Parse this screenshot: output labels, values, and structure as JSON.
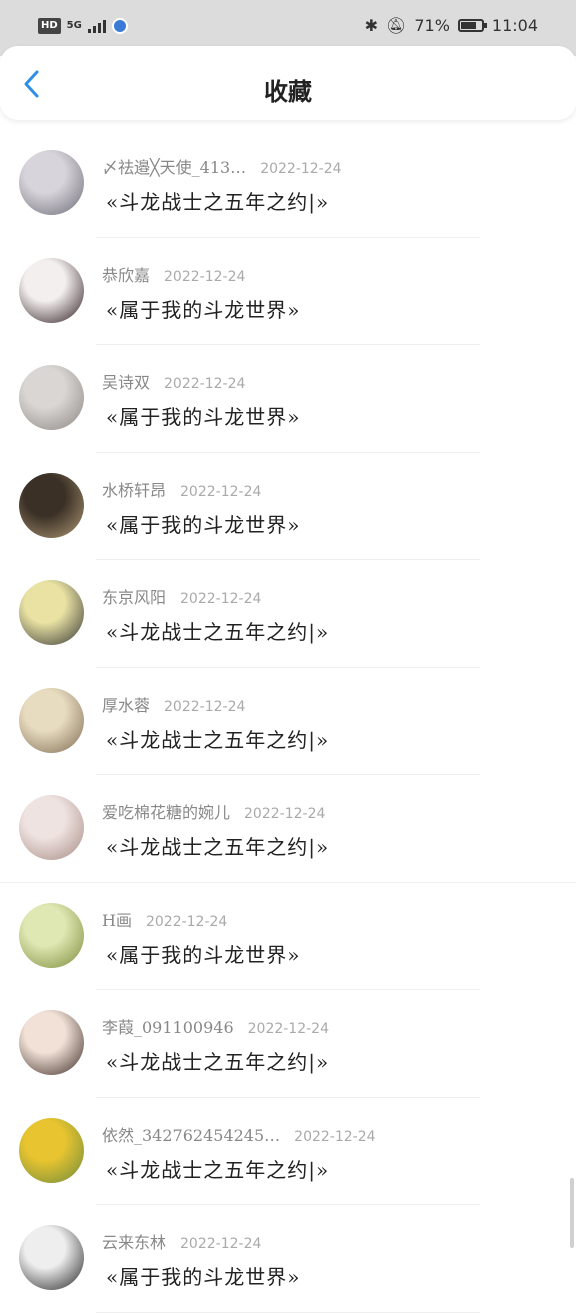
{
  "status_bar": {
    "left_badge": "HD",
    "network": "5G",
    "battery_percent": "71%",
    "time": "11:04",
    "battery_level": 0.71
  },
  "header": {
    "title": "收藏",
    "back_icon": "chevron-left-icon",
    "accent": "#2f8ee8"
  },
  "favorites": [
    {
      "user": "〆祛邉╳天使_413…",
      "date": "2022-12-24",
      "book": "«斗龙战士之五年之约|»",
      "avatar_colors": [
        "#d8d4dc",
        "#6b6b73"
      ]
    },
    {
      "user": "恭欣嘉",
      "date": "2022-12-24",
      "book": "«属于我的斗龙世界»",
      "avatar_colors": [
        "#f4efef",
        "#2a1a1e"
      ]
    },
    {
      "user": "吴诗双",
      "date": "2022-12-24",
      "book": "«属于我的斗龙世界»",
      "avatar_colors": [
        "#d9d6d4",
        "#8c8580"
      ]
    },
    {
      "user": "水桥轩昂",
      "date": "2022-12-24",
      "book": "«属于我的斗龙世界»",
      "avatar_colors": [
        "#3a3026",
        "#b09a76"
      ]
    },
    {
      "user": "东京风阳",
      "date": "2022-12-24",
      "book": "«斗龙战士之五年之约|»",
      "avatar_colors": [
        "#e9e2a3",
        "#333333"
      ]
    },
    {
      "user": "厚水蓉",
      "date": "2022-12-24",
      "book": "«斗龙战士之五年之约|»",
      "avatar_colors": [
        "#e8dcc0",
        "#7d6a52"
      ]
    },
    {
      "user": "爱吃棉花糖的婉儿",
      "date": "2022-12-24",
      "book": "«斗龙战士之五年之约|»",
      "avatar_colors": [
        "#efe3e1",
        "#a58a82"
      ]
    },
    {
      "user": "H画",
      "date": "2022-12-24",
      "book": "«属于我的斗龙世界»",
      "avatar_colors": [
        "#dfe7b2",
        "#7a8a3a"
      ]
    },
    {
      "user": "李葭_091100946",
      "date": "2022-12-24",
      "book": "«斗龙战士之五年之约|»",
      "avatar_colors": [
        "#f2e1d6",
        "#3a2a24"
      ]
    },
    {
      "user": "依然_342762454245…",
      "date": "2022-12-24",
      "book": "«斗龙战士之五年之约|»",
      "avatar_colors": [
        "#e7c430",
        "#6d8a3c"
      ]
    },
    {
      "user": "云来东林",
      "date": "2022-12-24",
      "book": "«属于我的斗龙世界»",
      "avatar_colors": [
        "#eeeeee",
        "#222222"
      ]
    }
  ]
}
